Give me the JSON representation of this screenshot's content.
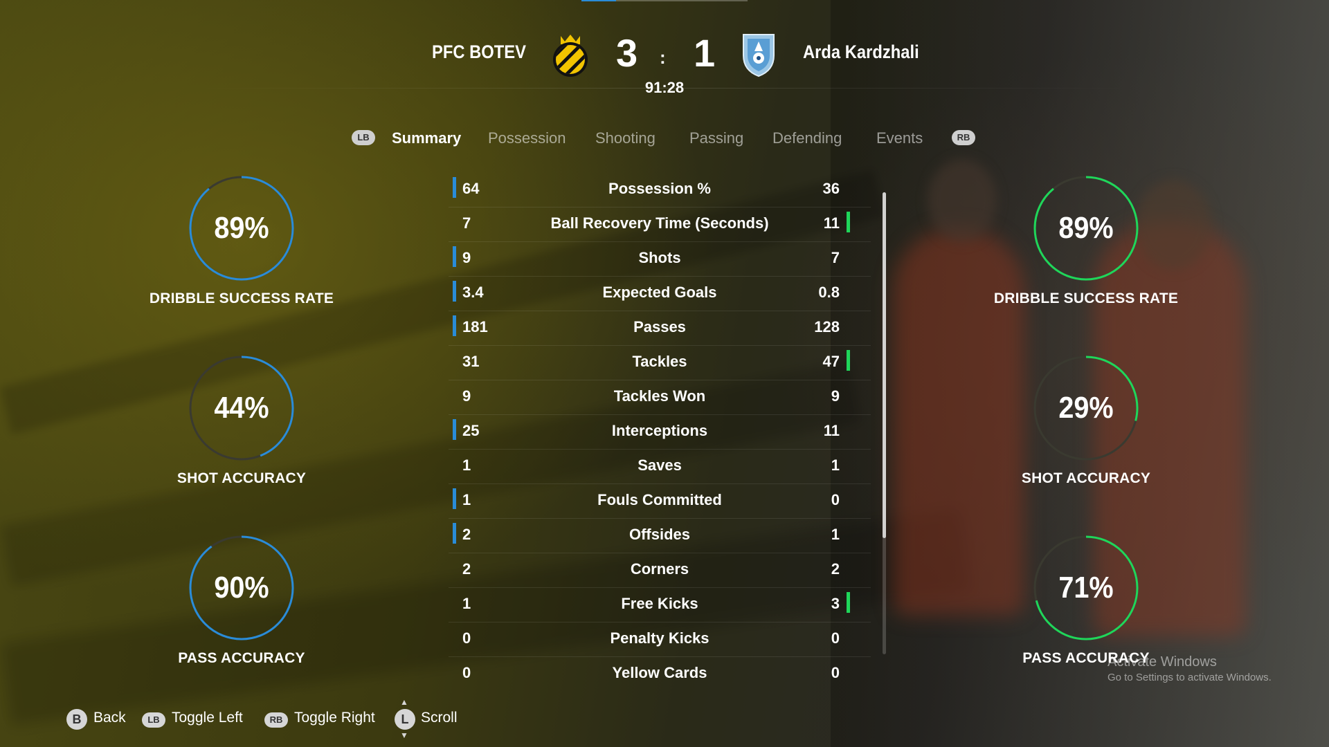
{
  "match": {
    "home_team": "PFC BOTEV",
    "away_team": "Arda Kardzhali",
    "home_score": "3",
    "separator": ":",
    "away_score": "1",
    "clock": "91:28"
  },
  "tabs": {
    "left_button": "LB",
    "right_button": "RB",
    "items": [
      "Summary",
      "Possession",
      "Shooting",
      "Passing",
      "Defending",
      "Events"
    ],
    "active": "Summary"
  },
  "home_gauges": [
    {
      "value": "89%",
      "label": "DRIBBLE SUCCESS RATE",
      "fraction": 0.89
    },
    {
      "value": "44%",
      "label": "SHOT ACCURACY",
      "fraction": 0.44
    },
    {
      "value": "90%",
      "label": "PASS ACCURACY",
      "fraction": 0.9
    }
  ],
  "away_gauges": [
    {
      "value": "89%",
      "label": "DRIBBLE SUCCESS RATE",
      "fraction": 0.89
    },
    {
      "value": "29%",
      "label": "SHOT ACCURACY",
      "fraction": 0.29
    },
    {
      "value": "71%",
      "label": "PASS ACCURACY",
      "fraction": 0.71
    }
  ],
  "colors": {
    "home_accent": "#2a8cd8",
    "away_accent": "#1fd65a",
    "gauge_track": "#3a3a30"
  },
  "stats": [
    {
      "home": "64",
      "label": "Possession %",
      "away": "36",
      "leader": "home"
    },
    {
      "home": "7",
      "label": "Ball Recovery Time (Seconds)",
      "away": "11",
      "leader": "away"
    },
    {
      "home": "9",
      "label": "Shots",
      "away": "7",
      "leader": "home"
    },
    {
      "home": "3.4",
      "label": "Expected Goals",
      "away": "0.8",
      "leader": "home"
    },
    {
      "home": "181",
      "label": "Passes",
      "away": "128",
      "leader": "home"
    },
    {
      "home": "31",
      "label": "Tackles",
      "away": "47",
      "leader": "away"
    },
    {
      "home": "9",
      "label": "Tackles Won",
      "away": "9",
      "leader": "none"
    },
    {
      "home": "25",
      "label": "Interceptions",
      "away": "11",
      "leader": "home"
    },
    {
      "home": "1",
      "label": "Saves",
      "away": "1",
      "leader": "none"
    },
    {
      "home": "1",
      "label": "Fouls Committed",
      "away": "0",
      "leader": "home"
    },
    {
      "home": "2",
      "label": "Offsides",
      "away": "1",
      "leader": "home"
    },
    {
      "home": "2",
      "label": "Corners",
      "away": "2",
      "leader": "none"
    },
    {
      "home": "1",
      "label": "Free Kicks",
      "away": "3",
      "leader": "away"
    },
    {
      "home": "0",
      "label": "Penalty Kicks",
      "away": "0",
      "leader": "none"
    },
    {
      "home": "0",
      "label": "Yellow Cards",
      "away": "0",
      "leader": "none"
    }
  ],
  "footer": {
    "back_key": "B",
    "back_label": "Back",
    "toggle_left_key": "LB",
    "toggle_left_label": "Toggle Left",
    "toggle_right_key": "RB",
    "toggle_right_label": "Toggle Right",
    "scroll_key": "L",
    "scroll_label": "Scroll"
  },
  "watermark": {
    "line1": "Activate Windows",
    "line2": "Go to Settings to activate Windows."
  }
}
